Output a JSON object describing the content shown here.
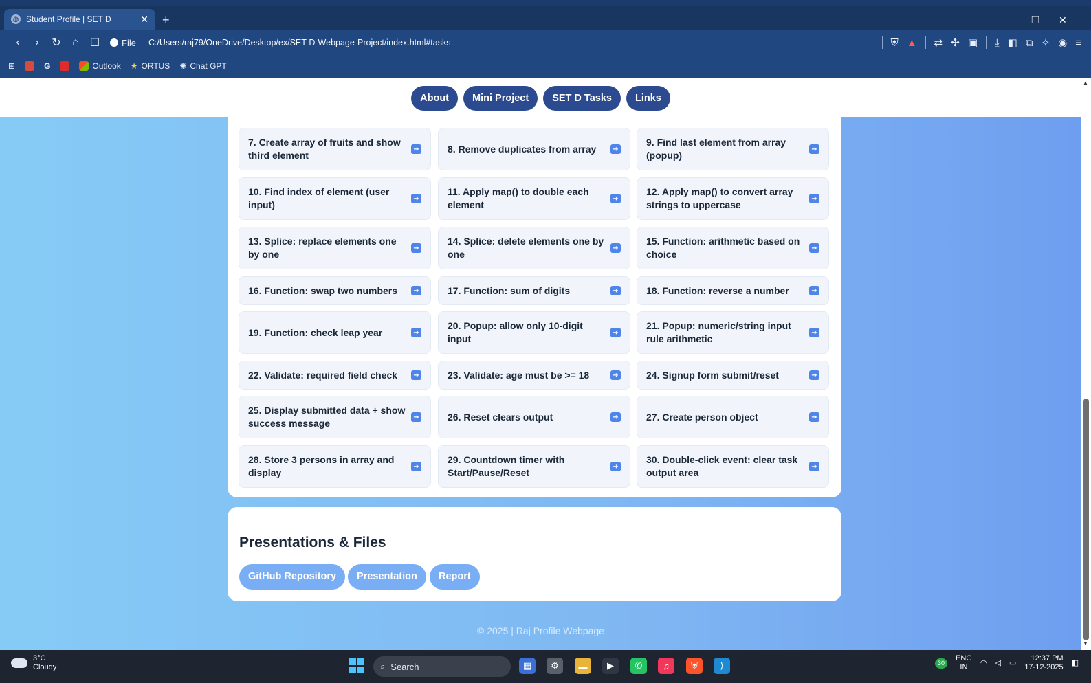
{
  "browser": {
    "tab_title": "Student Profile | SET D",
    "tab_close": "✕",
    "new_tab": "+",
    "site_info": "File",
    "url": "C:/Users/raj79/OneDrive/Desktop/ex/SET-D-Webpage-Project/index.html#tasks",
    "bookmarks": [
      "Outlook",
      "ORTUS",
      "Chat GPT"
    ]
  },
  "site_nav": [
    "About",
    "Mini Project",
    "SET D Tasks",
    "Links"
  ],
  "tasks": [
    "7. Create array of fruits and show third element",
    "8. Remove duplicates from array",
    "9. Find last element from array (popup)",
    "10. Find index of element (user input)",
    "11. Apply map() to double each element",
    "12. Apply map() to convert array strings to uppercase",
    "13. Splice: replace elements one by one",
    "14. Splice: delete elements one by one",
    "15. Function: arithmetic based on choice",
    "16. Function: swap two numbers",
    "17. Function: sum of digits",
    "18. Function: reverse a number",
    "19. Function: check leap year",
    "20. Popup: allow only 10-digit input",
    "21. Popup: numeric/string input rule arithmetic",
    "22. Validate: required field check",
    "23. Validate: age must be >= 18",
    "24. Signup form submit/reset",
    "25. Display submitted data + show success message",
    "26. Reset clears output",
    "27. Create person object",
    "28. Store 3 persons in array and display",
    "29. Countdown timer with Start/Pause/Reset",
    "30. Double-click event: clear task output area"
  ],
  "files": {
    "title": "Presentations & Files",
    "buttons": [
      "GitHub Repository",
      "Presentation",
      "Report"
    ]
  },
  "footer": "© 2025 | Raj Profile Webpage",
  "taskbar": {
    "temp": "3°C",
    "weather": "Cloudy",
    "search": "Search",
    "badge": "30",
    "lang": "ENG",
    "region": "IN",
    "time": "12:37 PM",
    "date": "17-12-2025"
  },
  "colors": {
    "nav_pill": "#2b4a8f",
    "task_icon": "#4f84e8",
    "file_button": "#79aef5"
  }
}
